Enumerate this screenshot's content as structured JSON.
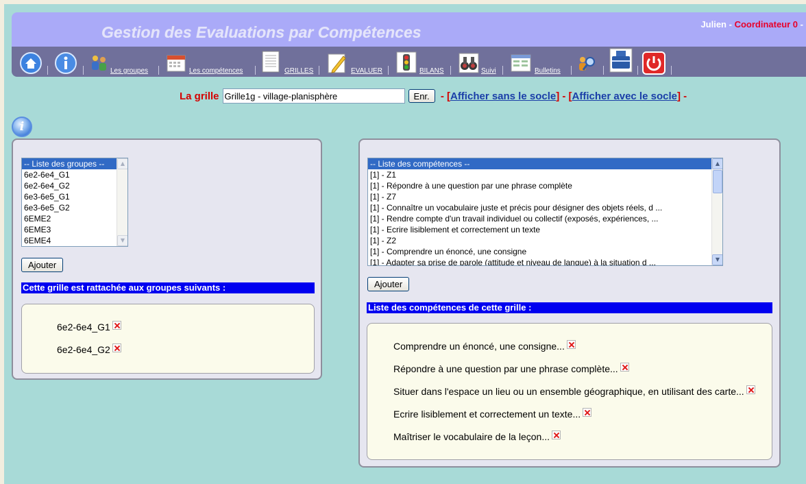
{
  "header": {
    "title": "Gestion des Evaluations par Compétences",
    "user_name": "Julien",
    "separator": " - ",
    "user_role": "Coordinateur 0",
    "trailing": " -"
  },
  "toolbar": {
    "items": [
      {
        "icon": "home-icon",
        "label": ""
      },
      {
        "icon": "info-icon",
        "label": ""
      },
      {
        "icon": "groups-icon",
        "label": "Les groupes"
      },
      {
        "icon": "calendar-icon",
        "label": "Les compétences"
      },
      {
        "icon": "document-icon",
        "label": "GRILLES"
      },
      {
        "icon": "pencil-icon",
        "label": "EVALUER"
      },
      {
        "icon": "traffic-light-icon",
        "label": "BILANS"
      },
      {
        "icon": "binoculars-icon",
        "label": "Suivi"
      },
      {
        "icon": "bulletin-icon",
        "label": "Bulletins"
      },
      {
        "icon": "search-person-icon",
        "label": ""
      },
      {
        "icon": "toolbox-icon",
        "label": ""
      },
      {
        "icon": "power-icon",
        "label": ""
      }
    ]
  },
  "grid": {
    "label": "La grille",
    "value": "Grille1g - village-planisphère",
    "save_button": "Enr.",
    "dash1": " - [",
    "link_without": "Afficher sans le socle",
    "dash2": "] - [",
    "link_with": "Afficher avec le socle",
    "dash3": "] -"
  },
  "groups_panel": {
    "list": [
      "-- Liste des groupes --",
      "6e2-6e4_G1",
      "6e2-6e4_G2",
      "6e3-6e5_G1",
      "6e3-6e5_G2",
      "6EME2",
      "6EME3",
      "6EME4"
    ],
    "add_button": "Ajouter",
    "section_title": "Cette grille est rattachée aux groupes suivants :",
    "attached": [
      "6e2-6e4_G1",
      "6e2-6e4_G2"
    ]
  },
  "skills_panel": {
    "list": [
      "-- Liste des compétences --",
      "[1] - Z1",
      "[1] - Répondre à une question par une phrase complète",
      "[1] - Z7",
      "[1] - Connaître un vocabulaire juste et précis pour désigner des objets réels, d ...",
      "[1] - Rendre compte d'un travail individuel ou collectif (exposés, expériences, ...",
      "[1] - Ecrire lisiblement et correctement un texte",
      "[1] - Z2",
      "[1] - Comprendre un énoncé, une consigne",
      "[1] - Adapter sa prise de parole (attitude et niveau de langue) à la situation d ..."
    ],
    "add_button": "Ajouter",
    "section_title": "Liste des compétences de cette grille :",
    "attached": [
      "Comprendre un énoncé, une consigne...",
      "Répondre à une question par une phrase complète...",
      "Situer dans l'espace un lieu ou un ensemble géographique, en utilisant des carte...",
      "Ecrire lisiblement et correctement un texte...",
      "Maîtriser le vocabulaire de la leçon..."
    ]
  },
  "colors": {
    "background": "#a8dad7",
    "header": "#aaaaf8",
    "toolbar": "#70709b",
    "accent_red": "#d40000",
    "section_bar": "#0000f0"
  }
}
